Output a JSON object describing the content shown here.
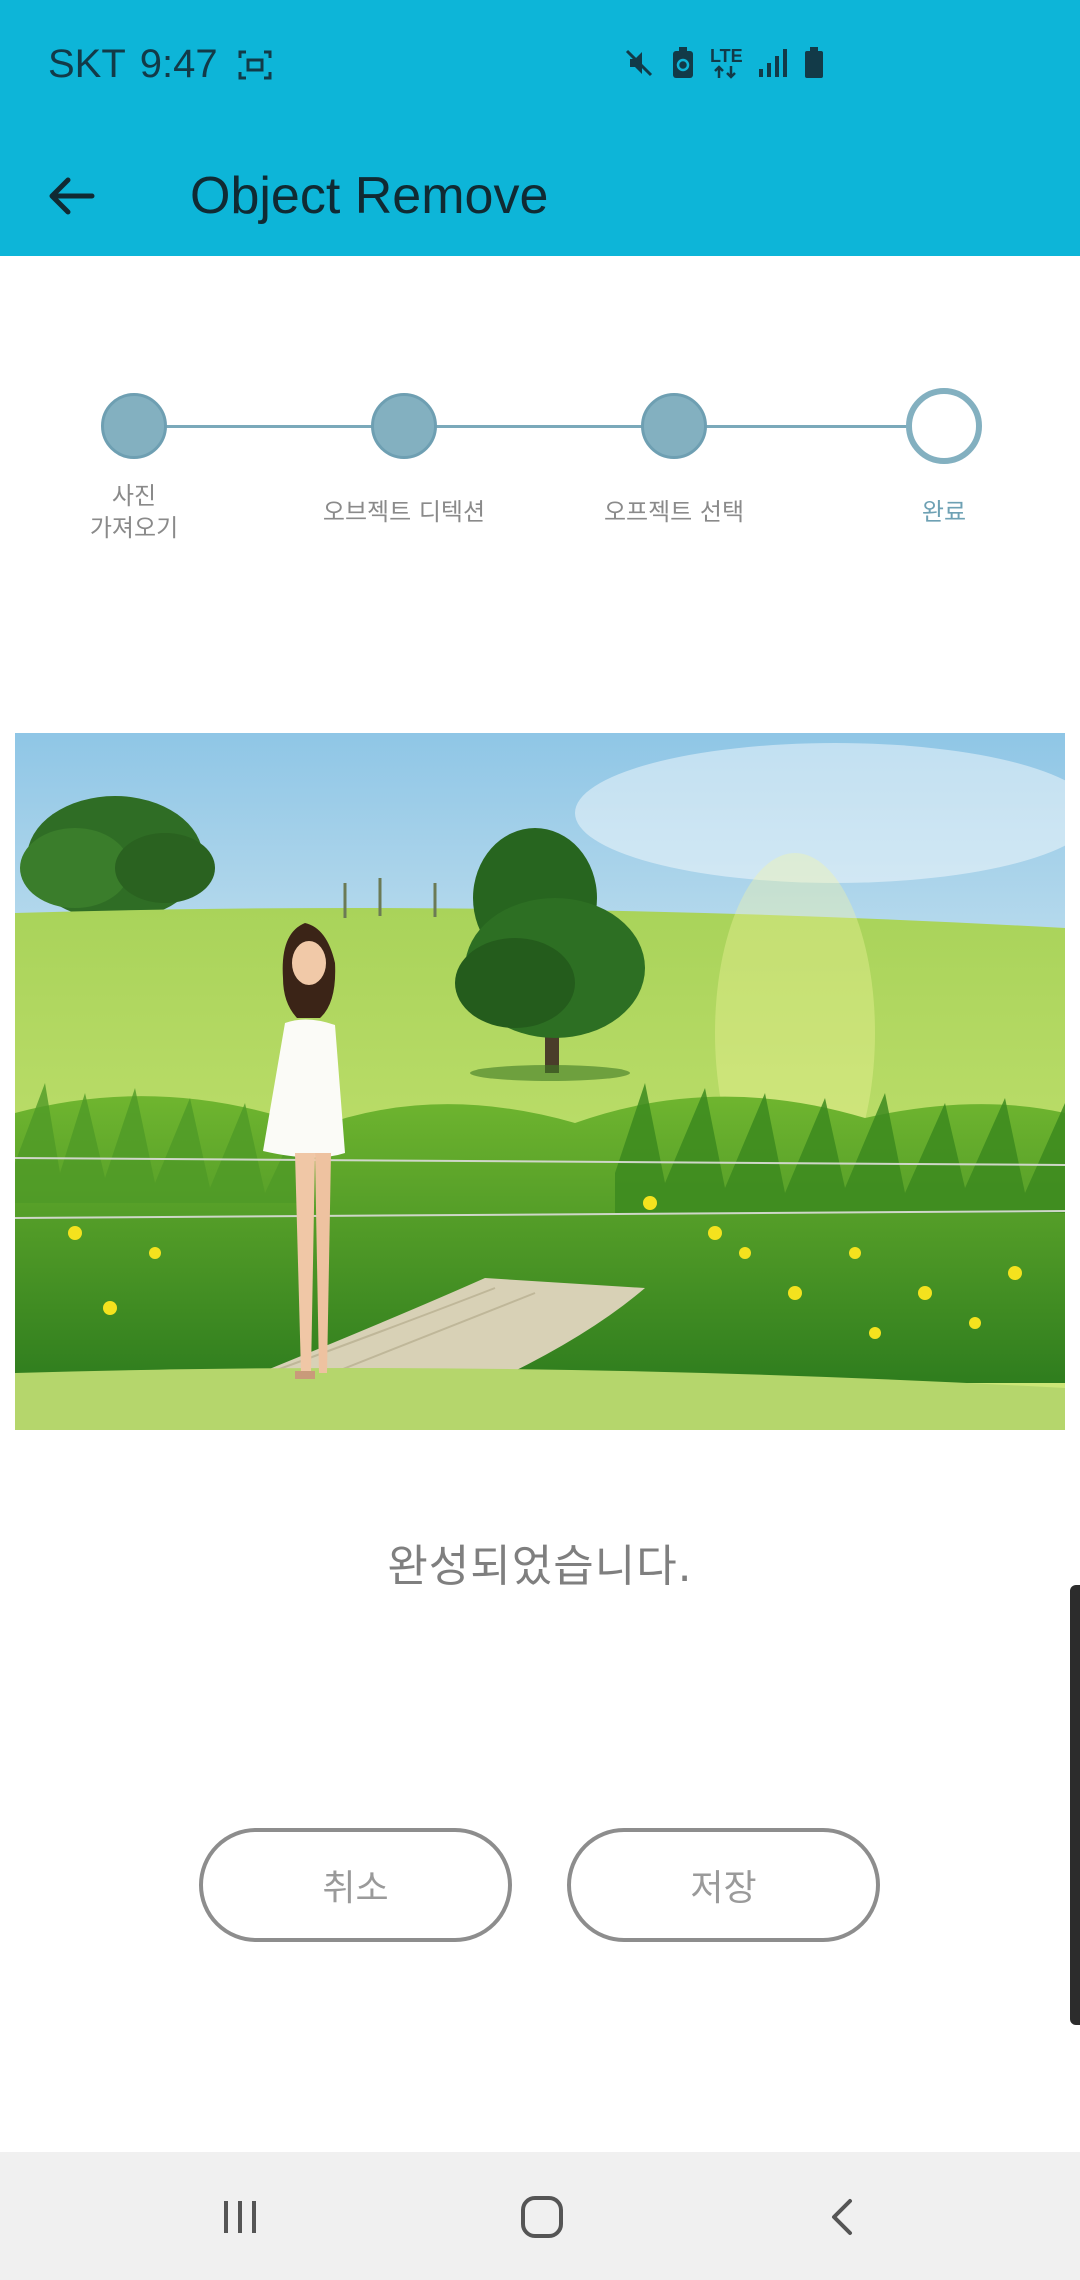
{
  "status_bar": {
    "carrier": "SKT",
    "time": "9:47",
    "network": "LTE",
    "icons": [
      "screenshot-icon",
      "mute-icon",
      "battery-saver-icon",
      "lte-icon",
      "signal-icon",
      "battery-icon"
    ]
  },
  "app_bar": {
    "title": "Object Remove",
    "back_icon": "arrow-left-icon"
  },
  "stepper": {
    "steps": [
      {
        "label_line1": "사진",
        "label_line2": "가져오기",
        "state": "done"
      },
      {
        "label_line1": "오브젝트 디텍션",
        "label_line2": "",
        "state": "done"
      },
      {
        "label_line1": "오프젝트 선택",
        "label_line2": "",
        "state": "done"
      },
      {
        "label_line1": "완료",
        "label_line2": "",
        "state": "current"
      }
    ]
  },
  "result": {
    "message": "완성되었습니다."
  },
  "actions": {
    "cancel_label": "취소",
    "save_label": "저장"
  },
  "colors": {
    "app_bar": "#0db5d8",
    "step": "#83b0c0",
    "step_active_text": "#6ea1b4",
    "button_border": "#8d8d8d"
  },
  "nav_bar": {
    "icons": [
      "recent-apps-icon",
      "home-icon",
      "back-icon"
    ]
  }
}
